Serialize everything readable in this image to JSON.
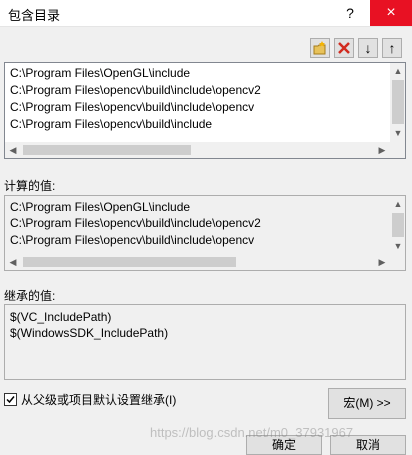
{
  "window": {
    "title": "包含目录",
    "help": "?",
    "close": "×"
  },
  "toolbar": {
    "new_line": "new-folder-icon",
    "delete": "delete-icon",
    "move_down": "↓",
    "move_up": "↑"
  },
  "main_list": {
    "items": [
      "C:\\Program Files\\OpenGL\\include",
      "C:\\Program Files\\opencv\\build\\include\\opencv2",
      "C:\\Program Files\\opencv\\build\\include\\opencv",
      "C:\\Program Files\\opencv\\build\\include"
    ]
  },
  "evaluated": {
    "label": "计算的值:",
    "items": [
      "C:\\Program Files\\OpenGL\\include",
      "C:\\Program Files\\opencv\\build\\include\\opencv2",
      "C:\\Program Files\\opencv\\build\\include\\opencv"
    ]
  },
  "inherited": {
    "label": "继承的值:",
    "items": [
      "$(VC_IncludePath)",
      "$(WindowsSDK_IncludePath)"
    ]
  },
  "inherit_checkbox": {
    "label": "从父级或项目默认设置继承(I)",
    "checked": true
  },
  "buttons": {
    "macro": "宏(M) >>",
    "ok": "确定",
    "cancel": "取消"
  },
  "watermark": "https://blog.csdn.net/m0_37931967"
}
